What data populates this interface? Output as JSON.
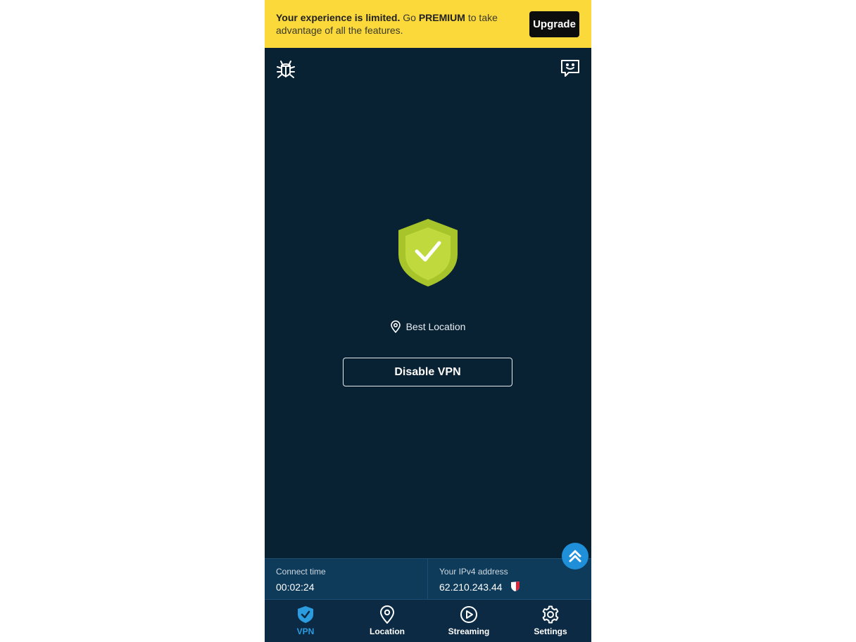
{
  "banner": {
    "strong": "Your experience is limited.",
    "text1": " Go ",
    "premium": "PREMIUM",
    "text2": " to take advantage of all the features.",
    "upgrade_label": "Upgrade"
  },
  "main": {
    "location": "Best Location",
    "disable_label": "Disable VPN"
  },
  "info": {
    "connect_label": "Connect time",
    "connect_value": "00:02:24",
    "ip_label": "Your IPv4 address",
    "ip_value": "62.210.243.44"
  },
  "tabs": [
    {
      "label": "VPN",
      "icon": "shield-check-icon",
      "active": true
    },
    {
      "label": "Location",
      "icon": "location-pin-icon",
      "active": false
    },
    {
      "label": "Streaming",
      "icon": "play-circle-icon",
      "active": false
    },
    {
      "label": "Settings",
      "icon": "gear-icon",
      "active": false
    }
  ],
  "colors": {
    "banner": "#fbd93b",
    "background": "#082133",
    "shield": "#b6d12e",
    "accent": "#2b9cdf"
  }
}
